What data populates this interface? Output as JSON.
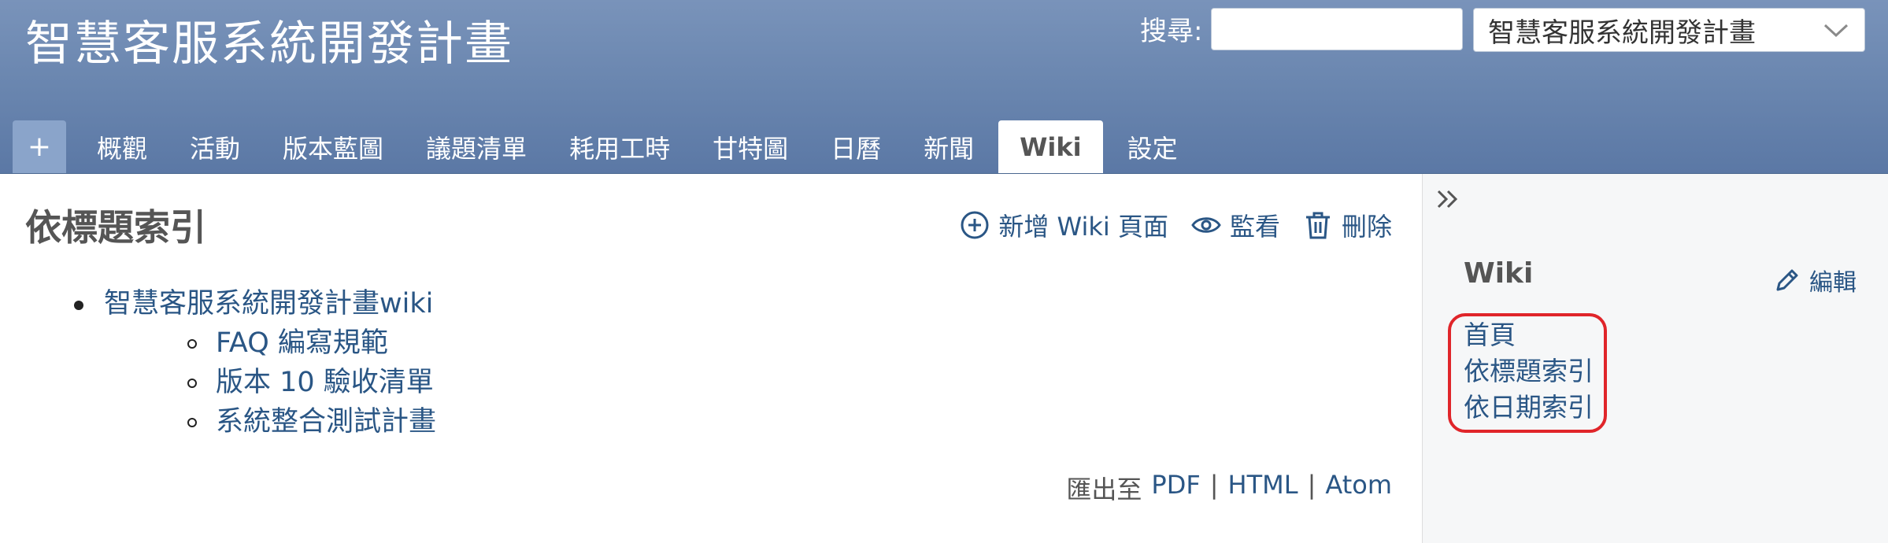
{
  "header": {
    "project_title": "智慧客服系統開發計畫",
    "search_label": "搜尋:",
    "search_value": "",
    "project_jump_selected": "智慧客服系統開發計畫"
  },
  "main_menu": {
    "new_object_label": "+",
    "tabs": [
      {
        "label": "概觀",
        "selected": false
      },
      {
        "label": "活動",
        "selected": false
      },
      {
        "label": "版本藍圖",
        "selected": false
      },
      {
        "label": "議題清單",
        "selected": false
      },
      {
        "label": "耗用工時",
        "selected": false
      },
      {
        "label": "甘特圖",
        "selected": false
      },
      {
        "label": "日曆",
        "selected": false
      },
      {
        "label": "新聞",
        "selected": false
      },
      {
        "label": "Wiki",
        "selected": true
      },
      {
        "label": "設定",
        "selected": false
      }
    ]
  },
  "content": {
    "heading": "依標題索引",
    "actions": {
      "new_page": "新增 Wiki 頁面",
      "watch": "監看",
      "delete": "刪除"
    },
    "index": {
      "root": "智慧客服系統開發計畫wiki",
      "children": [
        "FAQ 編寫規範",
        "版本 10 驗收清單",
        "系統整合測試計畫"
      ]
    },
    "export": {
      "label": "匯出至",
      "pdf": "PDF",
      "html": "HTML",
      "atom": "Atom",
      "separator": "|"
    }
  },
  "sidebar": {
    "title": "Wiki",
    "edit_label": "編輯",
    "links": [
      "首頁",
      "依標題索引",
      "依日期索引"
    ],
    "highlight_color": "#e0252a"
  },
  "colors": {
    "header_bg": "#6b87b0",
    "link": "#2a5685",
    "sidebar_bg": "#f6f7f8"
  }
}
